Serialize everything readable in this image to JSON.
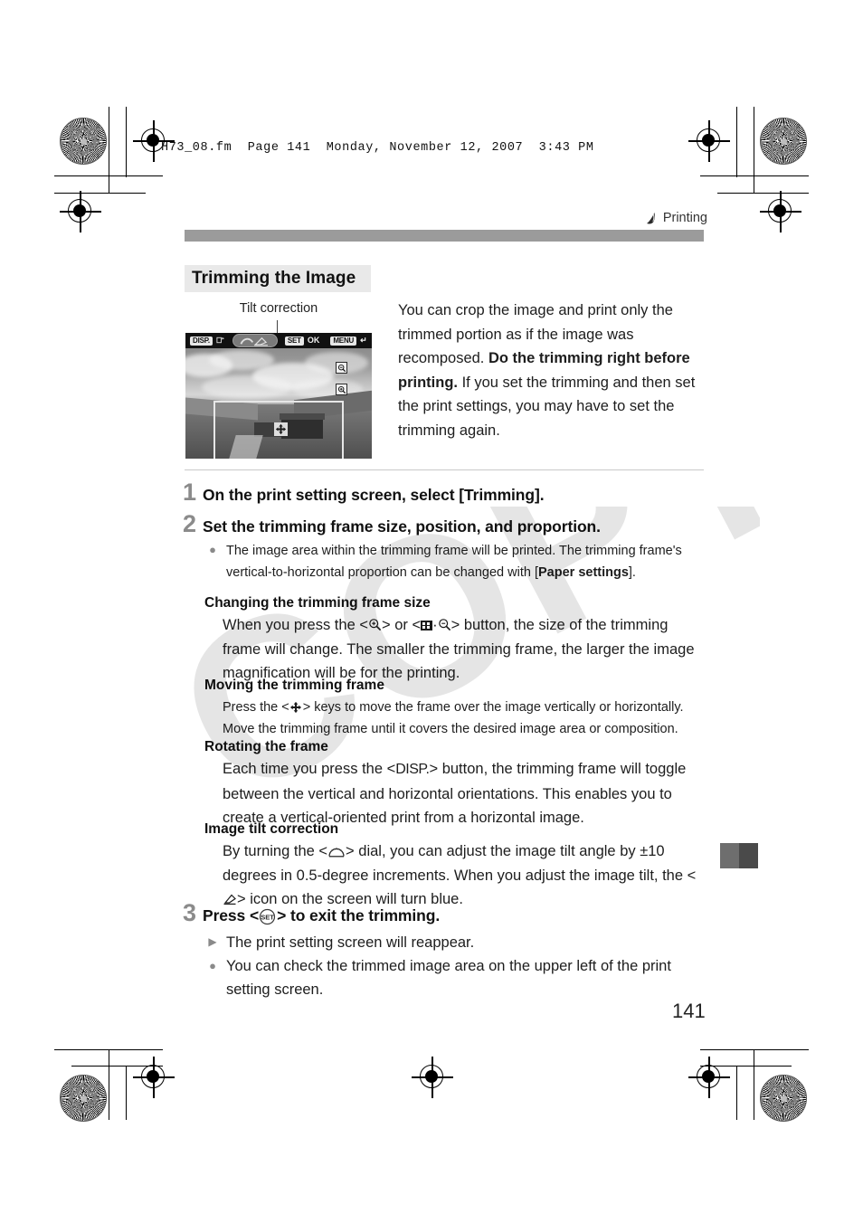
{
  "page": {
    "file_header": "H73_08.fm  Page 141  Monday, November 12, 2007  3:43 PM",
    "chapter_label": "Printing",
    "chapter_icon": "printer-icon",
    "section_title": "Trimming the Image",
    "page_number": "141",
    "watermark_text": "COPY"
  },
  "figure": {
    "caption": "Tilt correction",
    "lcd": {
      "btn_disp": "DISP.",
      "btn_disp_sub": "rotate-icon",
      "dial_icon": "tilt-dial-icon",
      "btn_set": "SET",
      "label_ok": "OK",
      "btn_menu": "MENU",
      "label_back": "back-arrow-icon",
      "icon_zoom_out": "magnify-minus-icon",
      "icon_zoom_in": "magnify-plus-icon",
      "icon_cross_keys": "cross-keys-icon",
      "trim_frame": "trimming-frame"
    }
  },
  "intro": {
    "part1": "You can crop the image and print only the trimmed portion as if the image was recomposed. ",
    "bold1": "Do the trimming right before printing.",
    "part2": " If you set the trimming and then set the print settings, you may have to set the trimming again."
  },
  "steps": [
    {
      "num": "1",
      "title": "On the print setting screen, select [Trimming]."
    },
    {
      "num": "2",
      "title": "Set the trimming frame size, position, and proportion."
    },
    {
      "num": "3",
      "title_pre": "Press <",
      "title_icon": "set-button-icon",
      "title_post": "> to exit the trimming."
    }
  ],
  "step2": {
    "bullet": {
      "pre": "The image area within the trimming frame will be printed. The trimming frame's vertical-to-horizontal proportion can be changed with [",
      "bold": "Paper settings",
      "post": "]."
    },
    "sub1": {
      "heading": "Changing the trimming frame size",
      "t1": "When you press the <",
      "icon1": "magnify-icon",
      "t2": "> or <",
      "icon2": "index-magnify-icon",
      "t3": "> button, the size of the trimming frame will change. The smaller the trimming frame, the larger the image magnification will be for the printing."
    },
    "sub2": {
      "heading": "Moving the trimming frame",
      "t1": "Press the <",
      "icon1": "cross-keys-icon",
      "t2": "> keys to move the frame over the image vertically or horizontally. Move the trimming frame until it covers the desired image area or composition."
    },
    "sub3": {
      "heading": "Rotating the frame",
      "t1": "Each time you press the <",
      "icon1": "DISP.",
      "t2": "> button, the trimming frame will toggle between the vertical and horizontal orientations. This enables you to create a vertical-oriented print from a horizontal image."
    },
    "sub4": {
      "heading": "Image tilt correction",
      "t1": "By turning the <",
      "icon1": "main-dial-icon",
      "t2": "> dial, you can adjust the image tilt angle by ±10 degrees in 0.5-degree increments. When you adjust the image tilt, the <",
      "icon2": "tilt-icon",
      "t3": "> icon on the screen will turn blue."
    }
  },
  "step3": {
    "bullets": [
      {
        "marker": "triangle",
        "text": "The print setting screen will reappear."
      },
      {
        "marker": "dot",
        "text": "You can check the trimmed image area on the upper left of the print setting screen."
      }
    ]
  },
  "colors": {
    "header_rule": "#9b9b9b",
    "section_bg": "#e9e9e9",
    "step_num": "#8b8b8b",
    "tab_light": "#6e6e6e",
    "tab_dark": "#4a4a4a"
  }
}
